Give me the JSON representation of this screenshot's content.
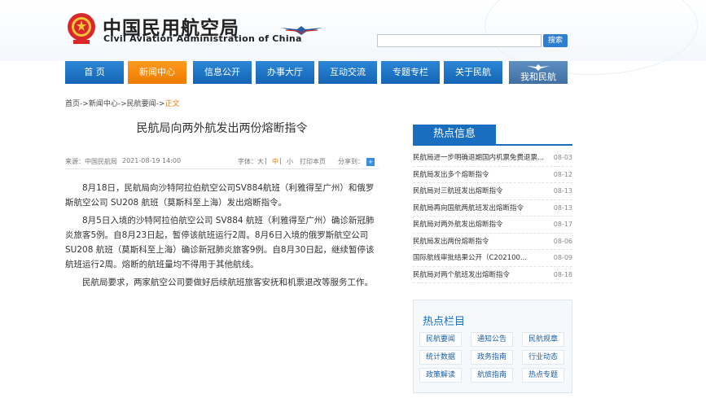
{
  "header": {
    "title_cn": "中国民用航空局",
    "title_en": "Civil Aviation Administration of China",
    "search_placeholder": "",
    "search_button": "搜索",
    "emblem_icon": "national-emblem-icon",
    "logo_icon": "caac-wings-logo"
  },
  "nav": {
    "items": [
      {
        "label": "首 页"
      },
      {
        "label": "新闻中心",
        "active": true
      },
      {
        "label": "信息公开"
      },
      {
        "label": "办事大厅"
      },
      {
        "label": "互动交流"
      },
      {
        "label": "专题专栏"
      },
      {
        "label": "关于民航"
      },
      {
        "label": "我和民航",
        "special": true
      }
    ]
  },
  "breadcrumb": {
    "parts": [
      "首页",
      "新闻中心",
      "民航要闻"
    ],
    "separator": "->",
    "current": "正文"
  },
  "article": {
    "title": "民航局向两外航发出两份熔断指令",
    "source": "来源：中国民航局",
    "date": "2021-08-19 14:00",
    "font_size_label": "字体：",
    "font_large": "大",
    "font_medium": "中",
    "font_small": "小",
    "print": "打印本页",
    "share": "分享到：",
    "paragraphs": [
      "8月18日，民航局向沙特阿拉伯航空公司SV884航班（利雅得至广州）和俄罗斯航空公司 SU208 航班（莫斯科至上海）发出熔断指令。",
      "8月5日入境的沙特阿拉伯航空公司 SV884 航班（利雅得至广州）确诊新冠肺炎旅客5例。自8月23日起，暂停该航班运行2周。8月6日入境的俄罗斯航空公司SU208 航班（莫斯科至上海）确诊新冠肺炎旅客9例。自8月30日起，继续暂停该航班运行2周。熔断的航班量均不得用于其他航线。",
      "民航局要求，两家航空公司要做好后续航班旅客安抚和机票退改等服务工作。"
    ]
  },
  "hot_info": {
    "tab_label": "热点信息",
    "items": [
      {
        "title": "民航局进一步明确退期国内机票免费退票...",
        "date": "08-03"
      },
      {
        "title": "民航局发出多个熔断指令",
        "date": "08-12"
      },
      {
        "title": "民航局对三航班发出熔断指令",
        "date": "08-13"
      },
      {
        "title": "民航局再向国航两航班发出熔断指令",
        "date": "08-13"
      },
      {
        "title": "民航局对两外航发出熔断指令",
        "date": "08-17"
      },
      {
        "title": "民航局发出两份熔断指令",
        "date": "08-06"
      },
      {
        "title": "国际航线审批结果公开（C202100...",
        "date": "08-09"
      },
      {
        "title": "民航局对两个航班发出熔断指令",
        "date": "08-18"
      }
    ]
  },
  "hot_columns": {
    "title": "热点栏目",
    "items": [
      {
        "label": "民航要闻"
      },
      {
        "label": "通知公告"
      },
      {
        "label": "民航规章"
      },
      {
        "label": "统计数据"
      },
      {
        "label": "政务指南"
      },
      {
        "label": "行业动态"
      },
      {
        "label": "政策解读"
      },
      {
        "label": "航旅指南"
      },
      {
        "label": "热点专题"
      }
    ]
  }
}
